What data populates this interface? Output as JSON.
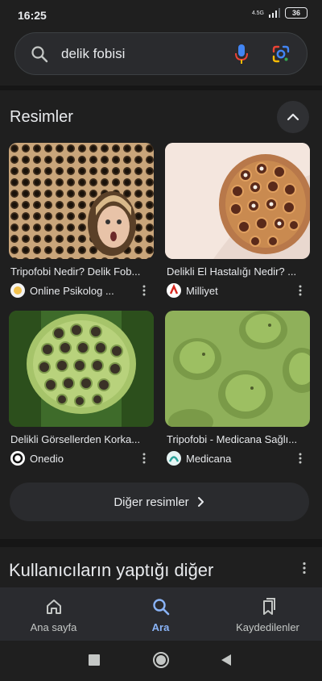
{
  "status_bar": {
    "time": "16:25",
    "network": "4.5G",
    "battery": "36"
  },
  "search": {
    "query": "delik fobisi",
    "icons": [
      "search-icon",
      "mic-icon",
      "google-lens-icon"
    ]
  },
  "images_section": {
    "title": "Resimler",
    "results": [
      {
        "title": "Tripofobi Nedir? Delik Fob...",
        "source": "Online Psikolog ...",
        "logo_icon": "online-psikolog-logo"
      },
      {
        "title": "Delikli El Hastalığı Nedir? ...",
        "source": "Milliyet",
        "logo_icon": "milliyet-logo"
      },
      {
        "title": "Delikli Görsellerden Korka...",
        "source": "Onedio",
        "logo_icon": "onedio-logo"
      },
      {
        "title": "Tripofobi - Medicana Sağlı...",
        "source": "Medicana",
        "logo_icon": "medicana-logo"
      }
    ],
    "more_button": "Diğer resimler"
  },
  "other_searches": {
    "title": "Kullanıcıların yaptığı diğer"
  },
  "bottom_nav": {
    "items": [
      {
        "label": "Ana sayfa",
        "icon": "home-icon",
        "active": false
      },
      {
        "label": "Ara",
        "icon": "search-icon",
        "active": true
      },
      {
        "label": "Kaydedilenler",
        "icon": "bookmarks-icon",
        "active": false
      }
    ]
  },
  "colors": {
    "background": "#1f1f1f",
    "surface": "#2a2b2e",
    "text": "#e8eaed",
    "accent": "#8ab4f8"
  }
}
